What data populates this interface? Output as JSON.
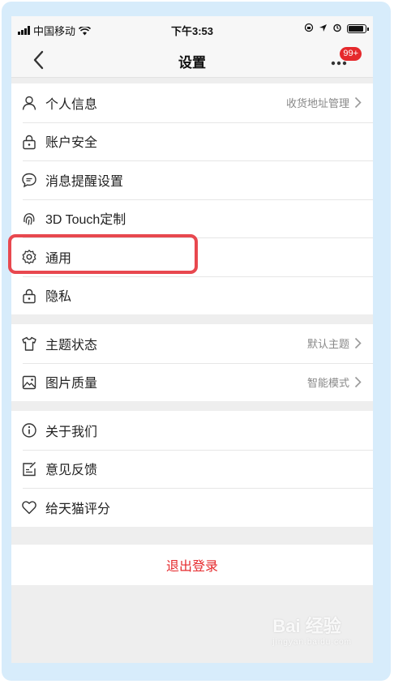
{
  "statusbar": {
    "carrier": "中国移动",
    "time": "下午3:53"
  },
  "navbar": {
    "title": "设置",
    "badge": "99+"
  },
  "groups": [
    {
      "items": [
        {
          "label": "个人信息",
          "right_text": "收货地址管理",
          "icon": "person-icon"
        },
        {
          "label": "账户安全",
          "right_text": "",
          "icon": "lock-icon"
        },
        {
          "label": "消息提醒设置",
          "right_text": "",
          "icon": "message-icon"
        },
        {
          "label": "3D Touch定制",
          "right_text": "",
          "icon": "fingerprint-icon"
        },
        {
          "label": "通用",
          "right_text": "",
          "icon": "gear-icon"
        },
        {
          "label": "隐私",
          "right_text": "",
          "icon": "lock-icon"
        }
      ]
    },
    {
      "items": [
        {
          "label": "主题状态",
          "right_text": "默认主题",
          "icon": "tshirt-icon"
        },
        {
          "label": "图片质量",
          "right_text": "智能模式",
          "icon": "image-icon"
        }
      ]
    },
    {
      "items": [
        {
          "label": "关于我们",
          "right_text": "",
          "icon": "info-icon"
        },
        {
          "label": "意见反馈",
          "right_text": "",
          "icon": "feedback-icon"
        },
        {
          "label": "给天猫评分",
          "right_text": "",
          "icon": "heart-icon"
        }
      ]
    }
  ],
  "logout_label": "退出登录",
  "watermark": {
    "brand": "Bai 经验",
    "url": "jingyan.baidu.com"
  },
  "colors": {
    "accent_red": "#e5292c",
    "frame_blue": "#d7ecfb",
    "highlight": "#e8484f"
  }
}
